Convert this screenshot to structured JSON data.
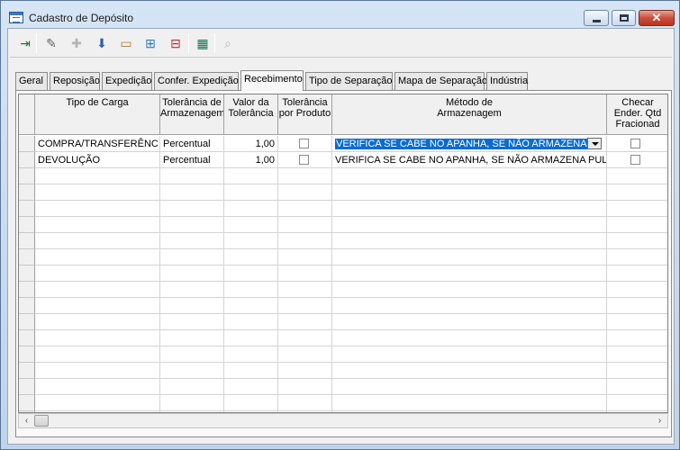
{
  "window": {
    "title": "Cadastro de Depósito"
  },
  "toolbar": [
    {
      "name": "exit-icon",
      "glyph": "⇥",
      "color": "#1d7a2f",
      "enabled": true
    },
    {
      "name": "eraser-icon",
      "glyph": "✎",
      "color": "#666666",
      "enabled": true
    },
    {
      "name": "add-disabled-icon",
      "glyph": "✚",
      "color": "#b4b4b4",
      "enabled": false
    },
    {
      "name": "save-download-icon",
      "glyph": "⬇",
      "color": "#2a5faa",
      "enabled": true
    },
    {
      "name": "open-folder-icon",
      "glyph": "▭",
      "color": "#b07a2a",
      "enabled": true
    },
    {
      "name": "insert-row-icon",
      "glyph": "⊞",
      "color": "#2a7ad0",
      "enabled": true
    },
    {
      "name": "delete-row-icon",
      "glyph": "⊟",
      "color": "#c02a2a",
      "enabled": true
    },
    {
      "name": "calculator-icon",
      "glyph": "▦",
      "color": "#1e6e52",
      "enabled": true
    },
    {
      "name": "binoculars-icon",
      "glyph": "⌕",
      "color": "#b4b4b4",
      "enabled": false
    }
  ],
  "tabs": [
    "Geral",
    "Reposição",
    "Expedição",
    "Confer. Expedição",
    "Recebimento",
    "Tipo de Separação",
    "Mapa de Separação",
    "Indústria"
  ],
  "active_tab": 4,
  "grid": {
    "columns": [
      {
        "key": "tipo_carga",
        "label": "Tipo de Carga"
      },
      {
        "key": "tol_armazenagem",
        "label": "Tolerância de\nArmazenagem"
      },
      {
        "key": "valor_tolerancia",
        "label": "Valor da\nTolerância"
      },
      {
        "key": "tol_produto",
        "label": "Tolerância\npor Produto"
      },
      {
        "key": "metodo",
        "label": "Método de\nArmazenagem"
      },
      {
        "key": "checar",
        "label": "Checar\nEnder. Qtd\nFracionad"
      }
    ],
    "rows": [
      {
        "tipo_carga": "COMPRA/TRANSFERÊNC",
        "tol_armazenagem": "Percentual",
        "valor_tolerancia": "1,00",
        "tol_produto": false,
        "metodo": "VERIFICA SE CABE NO APANHA, SE NÃO ARMAZENA",
        "checar": false
      },
      {
        "tipo_carga": "DEVOLUÇÃO",
        "tol_armazenagem": "Percentual",
        "valor_tolerancia": "1,00",
        "tol_produto": false,
        "metodo": "VERIFICA SE CABE NO APANHA, SE NÃO ARMAZENA PULM",
        "checar": false
      }
    ],
    "empty_rows": 16
  },
  "scrollbar": {
    "left_arrow": "‹",
    "right_arrow": "›"
  },
  "colors": {
    "selection": "#0a6cd0",
    "title_bg": "#c4d6ea"
  }
}
